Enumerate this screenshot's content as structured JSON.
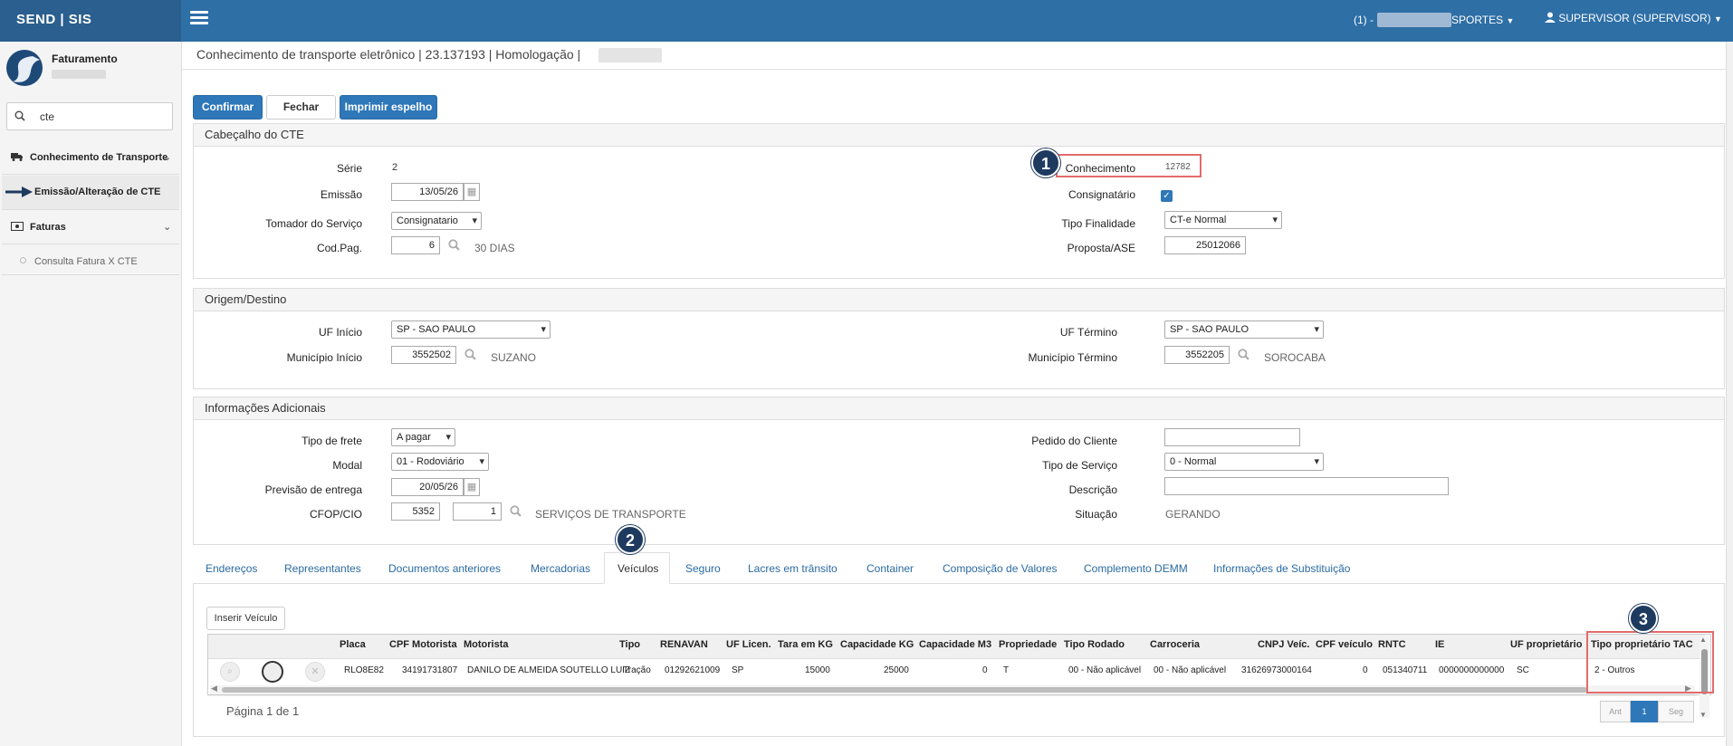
{
  "brand": "SEND | SIS",
  "header": {
    "company": "(1) - ",
    "company_suffix": "SPORTES",
    "user": "SUPERVISOR (SUPERVISOR)"
  },
  "sidebar": {
    "module": "Faturamento",
    "search_value": "cte",
    "items": [
      {
        "label": "Conhecimento de Transporte"
      },
      {
        "label": "Emissão/Alteração de CTE"
      },
      {
        "label": "Faturas"
      },
      {
        "label": "Consulta Fatura X CTE"
      }
    ]
  },
  "page": {
    "title": "Conhecimento de transporte eletrônico | 23.137193 | Homologação |"
  },
  "toolbar": {
    "confirm": "Confirmar",
    "close": "Fechar",
    "print": "Imprimir espelho"
  },
  "header_section": {
    "title": "Cabeçalho do CTE",
    "serie_label": "Série",
    "serie": "2",
    "emissao_label": "Emissão",
    "emissao": "13/05/26",
    "tomador_label": "Tomador do Serviço",
    "tomador": "Consignatario",
    "codpag_label": "Cod.Pag.",
    "codpag": "6",
    "codpag_desc": "30 DIAS",
    "conhecimento_label": "Conhecimento",
    "conhecimento": "12782",
    "consignatario_label": "Consignatário",
    "finalidade_label": "Tipo Finalidade",
    "finalidade": "CT-e Normal",
    "proposta_label": "Proposta/ASE",
    "proposta": "25012066"
  },
  "origem": {
    "title": "Origem/Destino",
    "uf_inicio_label": "UF Início",
    "uf_inicio": "SP - SAO PAULO",
    "mun_inicio_label": "Município Início",
    "mun_inicio": "3552502",
    "mun_inicio_desc": "SUZANO",
    "uf_termino_label": "UF Término",
    "uf_termino": "SP - SAO PAULO",
    "mun_termino_label": "Município Término",
    "mun_termino": "3552205",
    "mun_termino_desc": "SOROCABA"
  },
  "info": {
    "title": "Informações Adicionais",
    "frete_label": "Tipo de frete",
    "frete": "A pagar",
    "modal_label": "Modal",
    "modal": "01 - Rodoviário",
    "previsao_label": "Previsão de entrega",
    "previsao": "20/05/26",
    "cfop_label": "CFOP/CIO",
    "cfop": "5352",
    "cfop_seq": "1",
    "cfop_desc": "SERVIÇOS DE TRANSPORTE",
    "pedido_label": "Pedido do Cliente",
    "pedido": "",
    "tipo_servico_label": "Tipo de Serviço",
    "tipo_servico": "0 - Normal",
    "descricao_label": "Descrição",
    "descricao": "",
    "situacao_label": "Situação",
    "situacao": "GERANDO"
  },
  "tabs": [
    "Endereços",
    "Representantes",
    "Documentos anteriores",
    "Mercadorias",
    "Veículos",
    "Seguro",
    "Lacres em trânsito",
    "Container",
    "Composição de Valores",
    "Complemento DEMM",
    "Informações de Substituição"
  ],
  "vehicles": {
    "insert_button": "Inserir Veículo",
    "columns": [
      "Placa",
      "CPF Motorista",
      "Motorista",
      "Tipo",
      "RENAVAN",
      "UF Licen.",
      "Tara em KG",
      "Capacidade KG",
      "Capacidade M3",
      "Propriedade",
      "Tipo Rodado",
      "Carroceria",
      "CNPJ Veíc.",
      "CPF veículo",
      "RNTC",
      "IE",
      "UF proprietário",
      "Tipo proprietário TAC"
    ],
    "row": [
      "RLO8E82",
      "34191731807",
      "DANILO DE ALMEIDA SOUTELLO LUIZ",
      "Tração",
      "01292621009",
      "SP",
      "15000",
      "25000",
      "0",
      "T",
      "00 - Não aplicável",
      "00 - Não aplicável",
      "31626973000164",
      "0",
      "051340711",
      "0000000000000",
      "SC",
      "2 - Outros"
    ],
    "pagination": "Página 1 de 1",
    "prev": "Ant",
    "page": "1",
    "next": "Seg"
  },
  "badges": [
    "1",
    "2",
    "3"
  ]
}
